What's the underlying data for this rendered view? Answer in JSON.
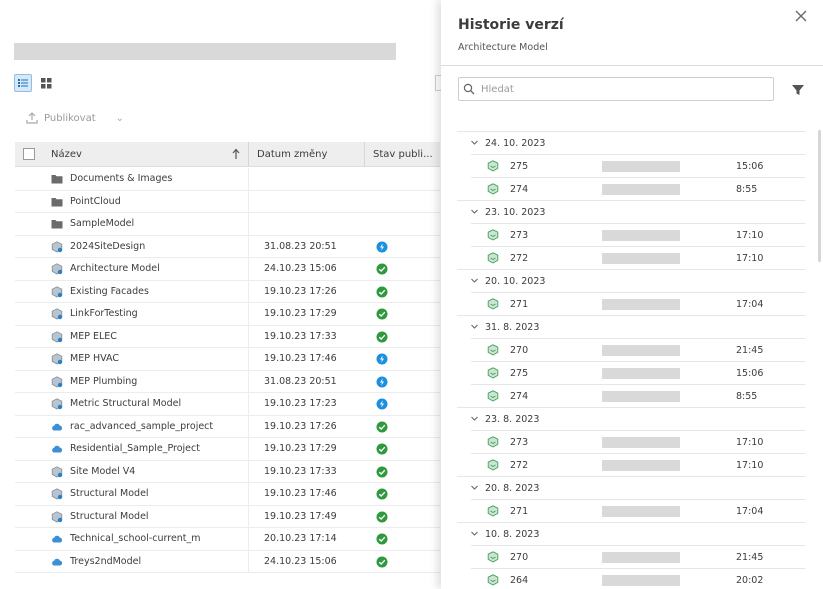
{
  "toolbar": {
    "publish_label": "Publikovat"
  },
  "table": {
    "columns": {
      "name": "Název",
      "date": "Datum změny",
      "status": "Stav publi..."
    },
    "rows": [
      {
        "name": "Documents & Images",
        "date": "",
        "type": "folder",
        "status": ""
      },
      {
        "name": "PointCloud",
        "date": "",
        "type": "folder",
        "status": ""
      },
      {
        "name": "SampleModel",
        "date": "",
        "type": "folder",
        "status": ""
      },
      {
        "name": "2024SiteDesign",
        "date": "31.08.23 20:51",
        "type": "model",
        "status": "processing"
      },
      {
        "name": "Architecture Model",
        "date": "24.10.23 15:06",
        "type": "model",
        "status": "ok"
      },
      {
        "name": "Existing Facades",
        "date": "19.10.23 17:26",
        "type": "model",
        "status": "ok"
      },
      {
        "name": "LinkForTesting",
        "date": "19.10.23 17:29",
        "type": "model",
        "status": "ok"
      },
      {
        "name": "MEP ELEC",
        "date": "19.10.23 17:33",
        "type": "model",
        "status": "ok"
      },
      {
        "name": "MEP HVAC",
        "date": "19.10.23 17:46",
        "type": "model",
        "status": "processing"
      },
      {
        "name": "MEP Plumbing",
        "date": "31.08.23 20:51",
        "type": "model",
        "status": "processing"
      },
      {
        "name": "Metric Structural Model",
        "date": "19.10.23 17:23",
        "type": "model",
        "status": "processing"
      },
      {
        "name": "rac_advanced_sample_project",
        "date": "19.10.23 17:26",
        "type": "cloud",
        "status": "ok"
      },
      {
        "name": "Residential_Sample_Project",
        "date": "19.10.23 17:29",
        "type": "cloud",
        "status": "ok"
      },
      {
        "name": "Site Model V4",
        "date": "19.10.23 17:33",
        "type": "model",
        "status": "ok"
      },
      {
        "name": "Structural Model",
        "date": "19.10.23 17:46",
        "type": "model",
        "status": "ok"
      },
      {
        "name": "Structural Model",
        "date": "19.10.23 17:49",
        "type": "model",
        "status": "ok"
      },
      {
        "name": "Technical_school-current_m",
        "date": "20.10.23 17:14",
        "type": "cloud",
        "status": "ok"
      },
      {
        "name": "Treys2ndModel",
        "date": "24.10.23 15:06",
        "type": "cloud",
        "status": "ok"
      }
    ]
  },
  "panel": {
    "title": "Historie verzí",
    "subtitle": "Architecture Model",
    "search_placeholder": "Hledat",
    "groups": [
      {
        "date": "24. 10. 2023",
        "versions": [
          {
            "num": "275",
            "time": "15:06"
          },
          {
            "num": "274",
            "time": "8:55"
          }
        ]
      },
      {
        "date": "23. 10. 2023",
        "versions": [
          {
            "num": "273",
            "time": "17:10"
          },
          {
            "num": "272",
            "time": "17:10"
          }
        ]
      },
      {
        "date": "20. 10. 2023",
        "versions": [
          {
            "num": "271",
            "time": "17:04"
          }
        ]
      },
      {
        "date": "31. 8. 2023",
        "versions": [
          {
            "num": "270",
            "time": "21:45"
          },
          {
            "num": "275",
            "time": "15:06"
          },
          {
            "num": "274",
            "time": "8:55"
          }
        ]
      },
      {
        "date": "23. 8. 2023",
        "versions": [
          {
            "num": "273",
            "time": "17:10"
          },
          {
            "num": "272",
            "time": "17:10"
          }
        ]
      },
      {
        "date": "20. 8. 2023",
        "versions": [
          {
            "num": "271",
            "time": "17:04"
          }
        ]
      },
      {
        "date": "10. 8. 2023",
        "versions": [
          {
            "num": "270",
            "time": "21:45"
          },
          {
            "num": "264",
            "time": "20:02"
          }
        ]
      }
    ]
  },
  "colors": {
    "ok": "#2e9a3d",
    "processing": "#1d8fe0",
    "accent": "#8fbfe6",
    "version_icon": "#3ea35a"
  }
}
